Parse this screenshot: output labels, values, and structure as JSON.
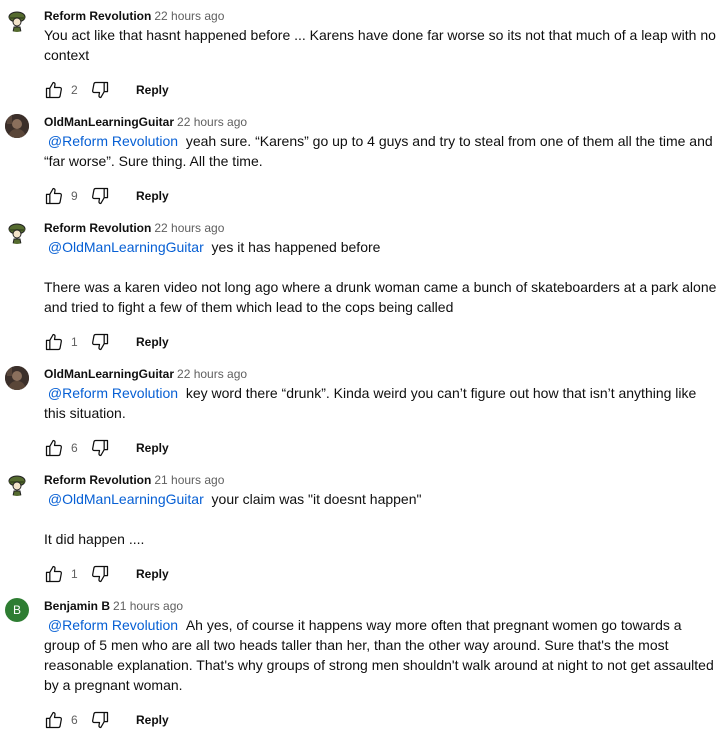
{
  "comments": [
    {
      "author": "Reform Revolution",
      "time": "22 hours ago",
      "avatar": "soldier-avatar",
      "mention": "",
      "paragraphs": [
        "You act like that hasnt happened before ... Karens have done far worse so its not that much of a leap with no context"
      ],
      "likes": "2",
      "reply_label": "Reply"
    },
    {
      "author": "OldManLearningGuitar",
      "time": "22 hours ago",
      "avatar": "photo-avatar",
      "mention": "@Reform Revolution",
      "paragraphs": [
        "yeah sure. “Karens” go up to 4 guys and try to steal from one of them all the time and “far worse”. Sure thing. All the time."
      ],
      "likes": "9",
      "reply_label": "Reply"
    },
    {
      "author": "Reform Revolution",
      "time": "22 hours ago",
      "avatar": "soldier-avatar",
      "mention": "@OldManLearningGuitar",
      "paragraphs": [
        "yes it has happened before",
        "There was a karen video not long ago where a drunk woman came a bunch of skateboarders at a park alone and tried to fight a few of them which lead to the cops being called"
      ],
      "likes": "1",
      "reply_label": "Reply"
    },
    {
      "author": "OldManLearningGuitar",
      "time": "22 hours ago",
      "avatar": "photo-avatar",
      "mention": "@Reform Revolution",
      "paragraphs": [
        "key word there “drunk”. Kinda weird you can’t figure out how that isn’t anything like this situation."
      ],
      "likes": "6",
      "reply_label": "Reply"
    },
    {
      "author": "Reform Revolution",
      "time": "21 hours ago",
      "avatar": "soldier-avatar",
      "mention": "@OldManLearningGuitar",
      "paragraphs": [
        "your claim was \"it doesnt happen\"",
        "It did happen ...."
      ],
      "likes": "1",
      "reply_label": "Reply"
    },
    {
      "author": "Benjamin B",
      "time": "21 hours ago",
      "avatar": "letter-avatar",
      "avatar_letter": "B",
      "mention": "@Reform Revolution",
      "paragraphs": [
        "Ah yes, of course it happens way more often that pregnant women go towards a group of 5 men who are all two heads taller than her, than the other way around. Sure that's the most reasonable explanation. That's why groups of strong men shouldn't walk around at night to not get assaulted by a pregnant woman."
      ],
      "likes": "6",
      "reply_label": "Reply"
    }
  ],
  "colors": {
    "mention": "#065fd4",
    "meta": "#606060",
    "letter_avatar": "#2e7d32"
  }
}
